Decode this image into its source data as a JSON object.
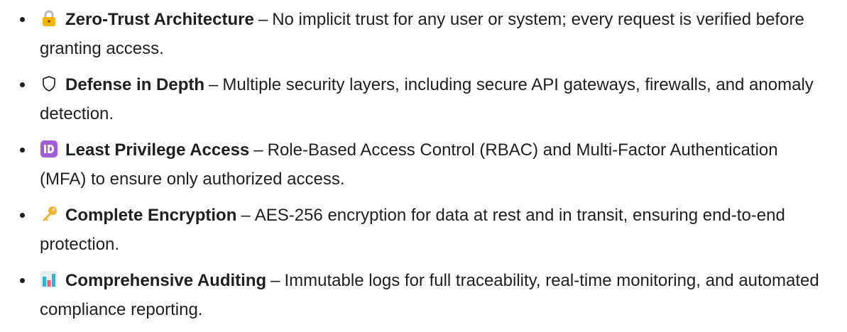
{
  "items": [
    {
      "icon": "padlock-icon",
      "title": "Zero-Trust Architecture",
      "separator": "–",
      "description": "No implicit trust for any user or system; every request is verified before granting access."
    },
    {
      "icon": "shield-icon",
      "title": "Defense in Depth",
      "separator": "–",
      "description": "Multiple security layers, including secure API gateways, firewalls, and anomaly detection."
    },
    {
      "icon": "id-badge-icon",
      "title": "Least Privilege Access",
      "separator": "–",
      "description": "Role-Based Access Control (RBAC) and Multi-Factor Authentication (MFA) to ensure only authorized access."
    },
    {
      "icon": "key-icon",
      "title": "Complete Encryption",
      "separator": "–",
      "description": "AES-256 encryption for data at rest and in transit, ensuring end-to-end protection."
    },
    {
      "icon": "bar-chart-icon",
      "title": "Comprehensive Auditing",
      "separator": "–",
      "description": "Immutable logs for full traceability, real-time monitoring, and automated compliance reporting."
    }
  ],
  "colors": {
    "text": "#1f1f1f",
    "lock_body": "#f5b400",
    "lock_shackle": "#b9b9b9",
    "id_badge": "#a25ddc",
    "key": "#f6b22d",
    "chart_bars": [
      "#2bb4d6",
      "#ef5b7a",
      "#2bb4d6"
    ]
  }
}
